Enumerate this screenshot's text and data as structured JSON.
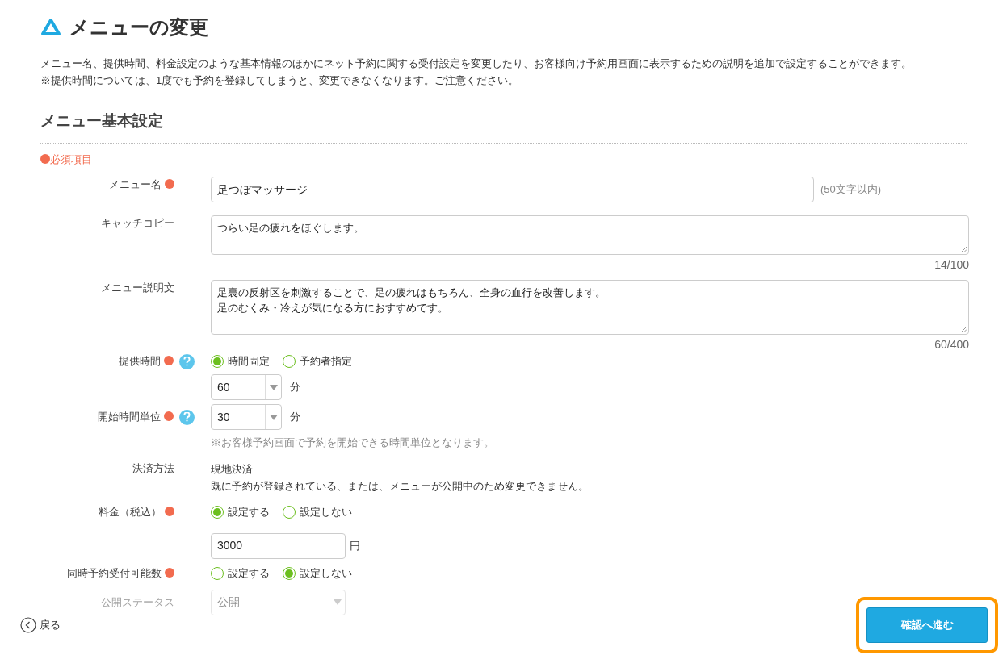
{
  "page": {
    "title": "メニューの変更",
    "intro": "メニュー名、提供時間、料金設定のような基本情報のほかにネット予約に関する受付設定を変更したり、お客様向け予約用画面に表示するための説明を追加で設定することができます。",
    "caution": "※提供時間については、1度でも予約を登録してしまうと、変更できなくなります。ご注意ください。"
  },
  "section": {
    "title": "メニュー基本設定",
    "required_note": "必須項目"
  },
  "fields": [
    {
      "kind": "text",
      "label": "メニュー名",
      "required": true,
      "value": "足つぼマッサージ",
      "hint": "(50文字以内)"
    },
    {
      "kind": "textarea",
      "label": "キャッチコピー",
      "lines": [
        "つらい足の疲れをほぐします。"
      ],
      "counter": "14/100"
    },
    {
      "kind": "textarea",
      "label": "メニュー説明文",
      "lines": [
        "足裏の反射区を刺激することで、足の疲れはもちろん、全身の血行を改善します。",
        "足のむくみ・冷えが気になる方におすすめです。"
      ],
      "counter": "60/400"
    },
    {
      "kind": "radio",
      "label": "提供時間",
      "required": true,
      "help": true,
      "options": [
        {
          "label": "時間固定",
          "selected": true
        },
        {
          "label": "予約者指定",
          "selected": false
        }
      ],
      "select": {
        "value": "60",
        "unit": "分"
      }
    },
    {
      "kind": "select",
      "label": "開始時間単位",
      "required": true,
      "help": true,
      "value": "30",
      "unit": "分",
      "note": "※お客様予約画面で予約を開始できる時間単位となります。"
    },
    {
      "kind": "static",
      "label": "決済方法",
      "lines": [
        "現地決済",
        "既に予約が登録されている、または、メニューが公開中のため変更できません。"
      ]
    },
    {
      "kind": "radio",
      "label": "料金（税込）",
      "required": true,
      "options": [
        {
          "label": "設定する",
          "selected": true
        },
        {
          "label": "設定しない",
          "selected": false
        }
      ],
      "input": {
        "value": "3000",
        "unit": "円"
      }
    },
    {
      "kind": "radio",
      "label": "同時予約受付可能数",
      "required": true,
      "options": [
        {
          "label": "設定する",
          "selected": false
        },
        {
          "label": "設定しない",
          "selected": true
        }
      ]
    },
    {
      "kind": "select",
      "label": "公開ステータス",
      "value": "公開"
    }
  ],
  "footer": {
    "back": "戻る",
    "next": "確認へ進む",
    "highlighted": true
  }
}
